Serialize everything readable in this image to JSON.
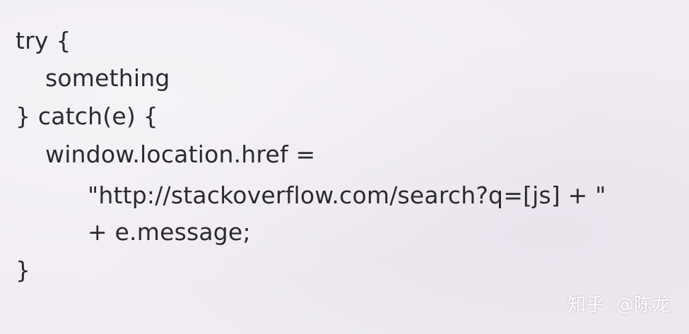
{
  "code": {
    "lines": [
      "try {",
      "something",
      "} catch(e) {",
      "window.location.href =",
      "\"http://stackoverflow.com/search?q=[js] + \"",
      "+ e.message;",
      "}"
    ]
  },
  "watermark": {
    "site": "知乎",
    "author": "@陈龙"
  },
  "colors": {
    "background": "#f1edf3",
    "text": "#2b2b2f",
    "watermark": "#ffffff"
  }
}
